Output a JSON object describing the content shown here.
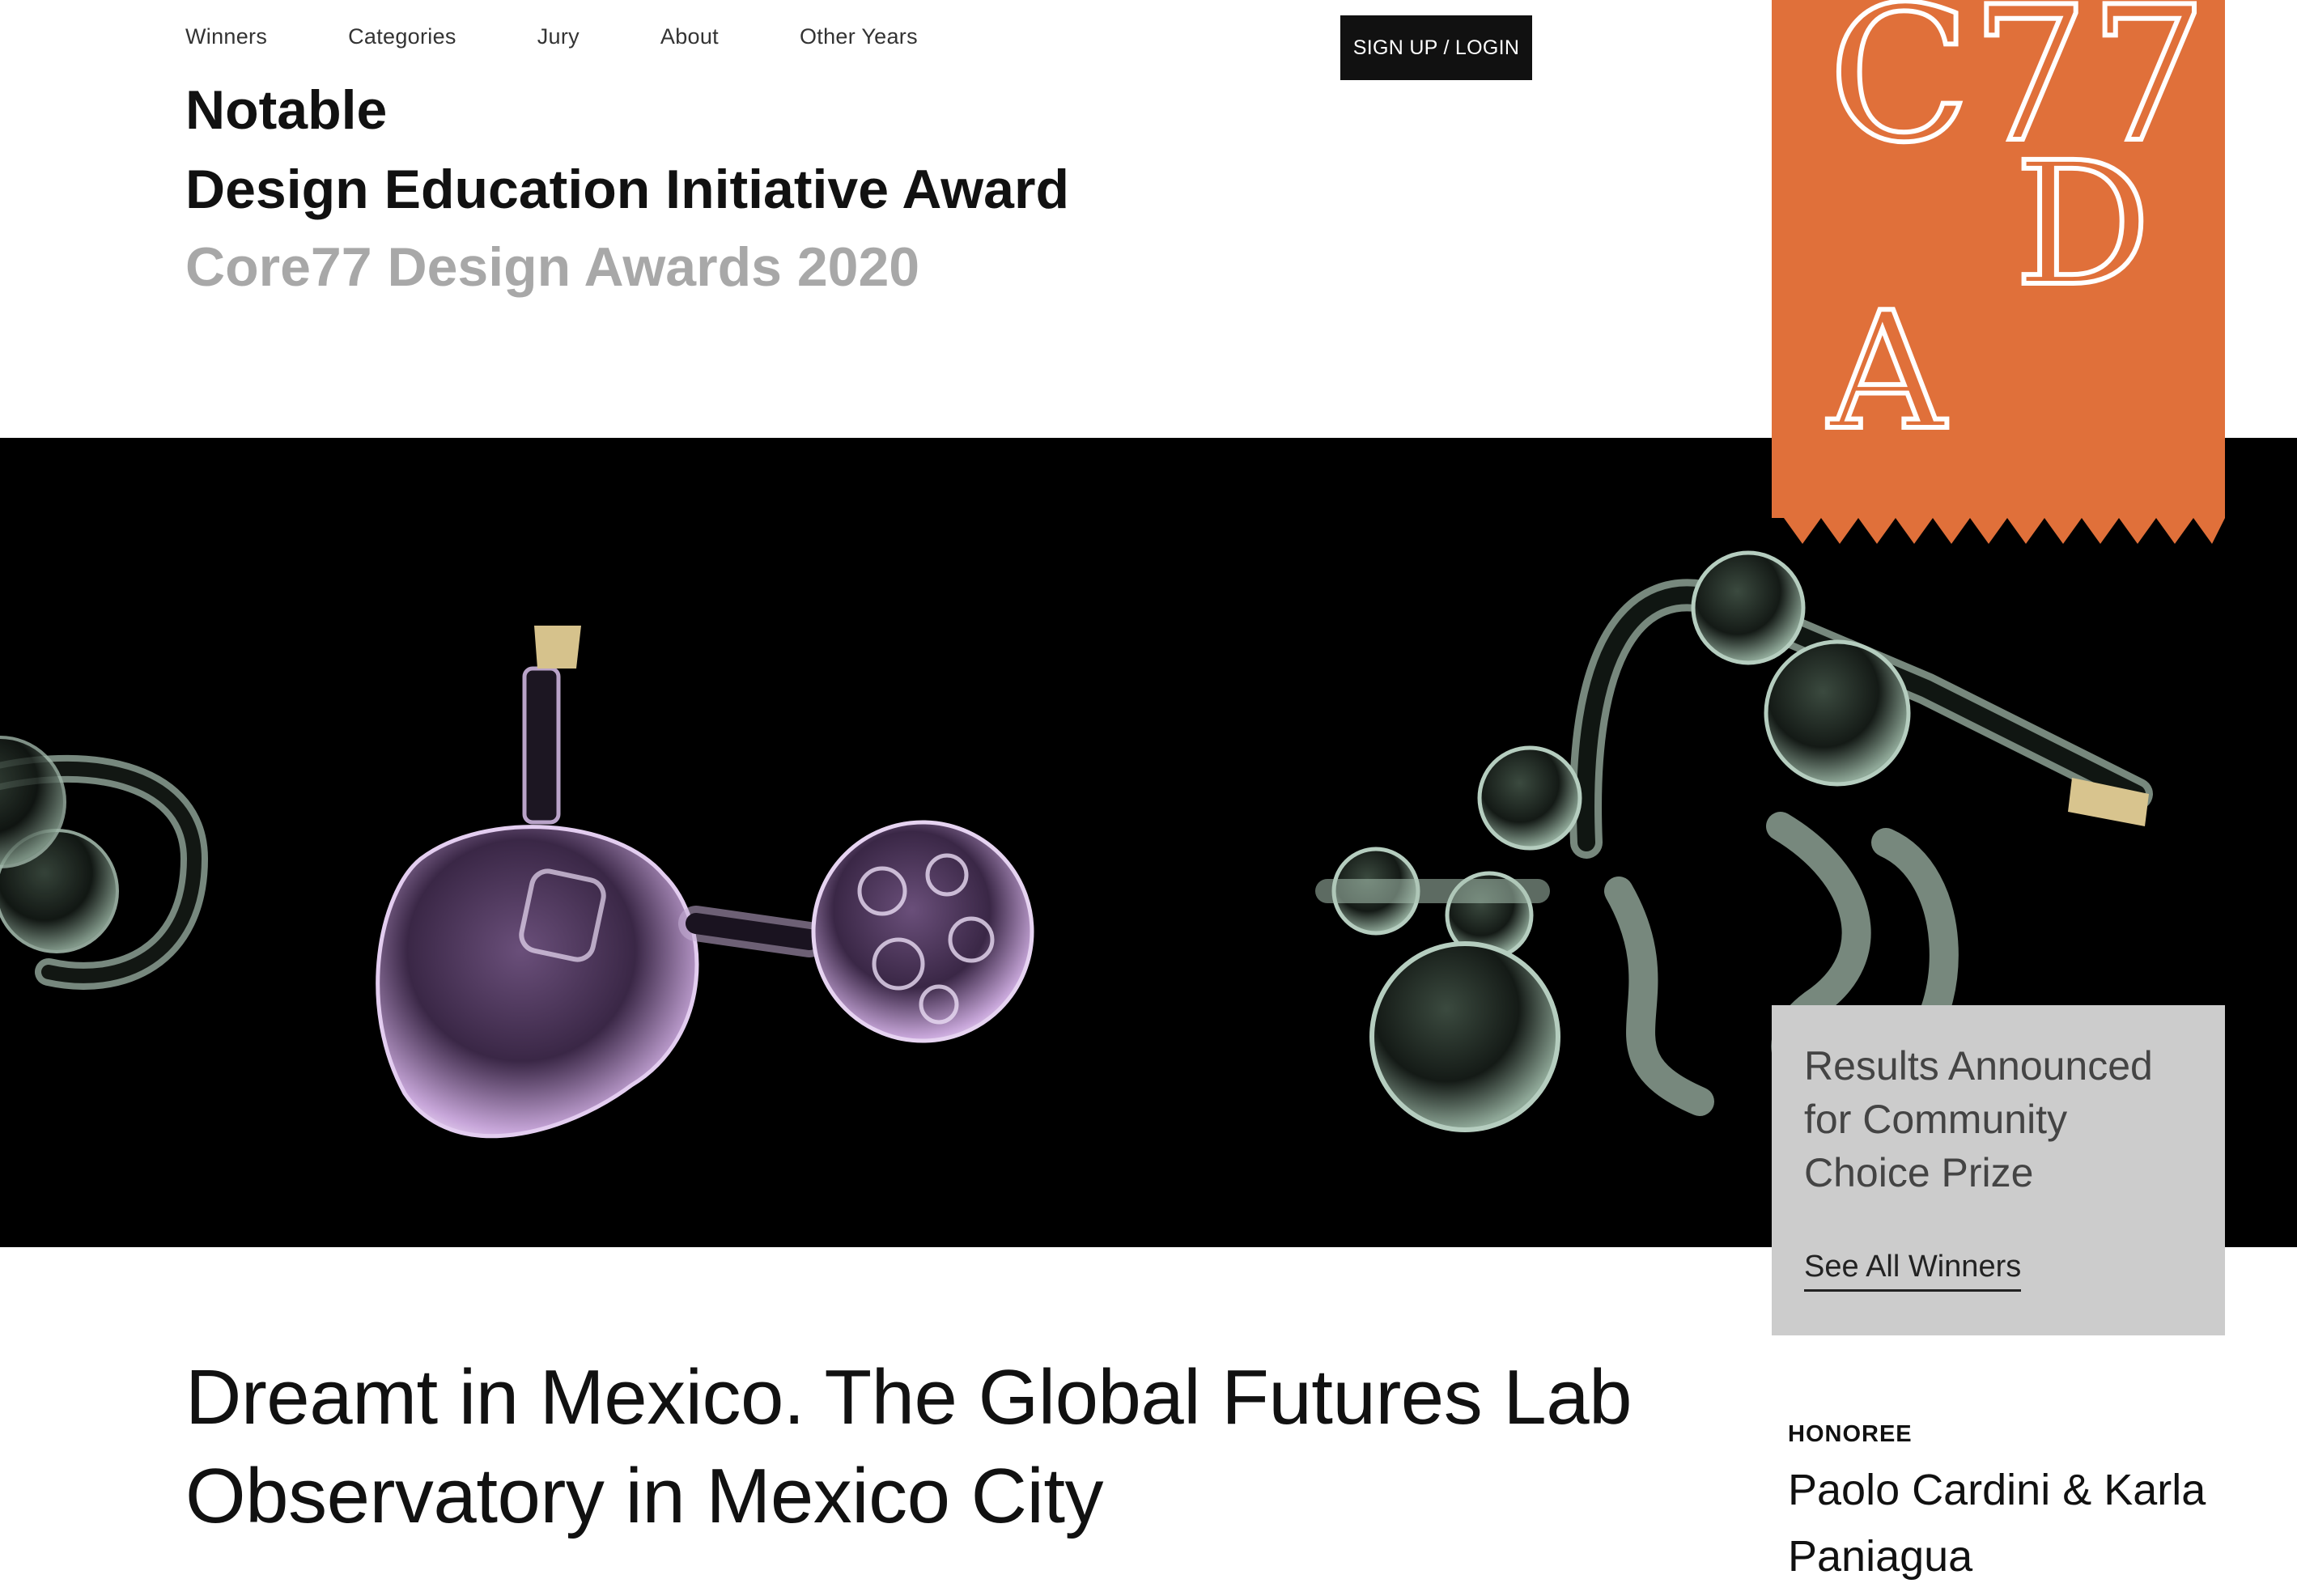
{
  "nav": {
    "items": [
      {
        "label": "Winners"
      },
      {
        "label": "Categories"
      },
      {
        "label": "Jury"
      },
      {
        "label": "About"
      },
      {
        "label": "Other Years"
      }
    ],
    "login_label": "SIGN UP / LOGIN"
  },
  "header": {
    "rank": "Notable",
    "award": "Design Education Initiative Award",
    "program": "Core77 Design Awards 2020"
  },
  "logo": {
    "line1": "C77",
    "line2": "D",
    "line3": "A",
    "color": "#E0703A"
  },
  "announcement": {
    "text": "Results Announced for Community Choice Prize",
    "link_label": "See All Winners"
  },
  "project": {
    "title": "Dreamt in Mexico. The Global Futures Lab Observatory in Mexico City"
  },
  "honoree": {
    "label": "HONOREE",
    "names": "Paolo Cardini & Karla Paniagua"
  }
}
